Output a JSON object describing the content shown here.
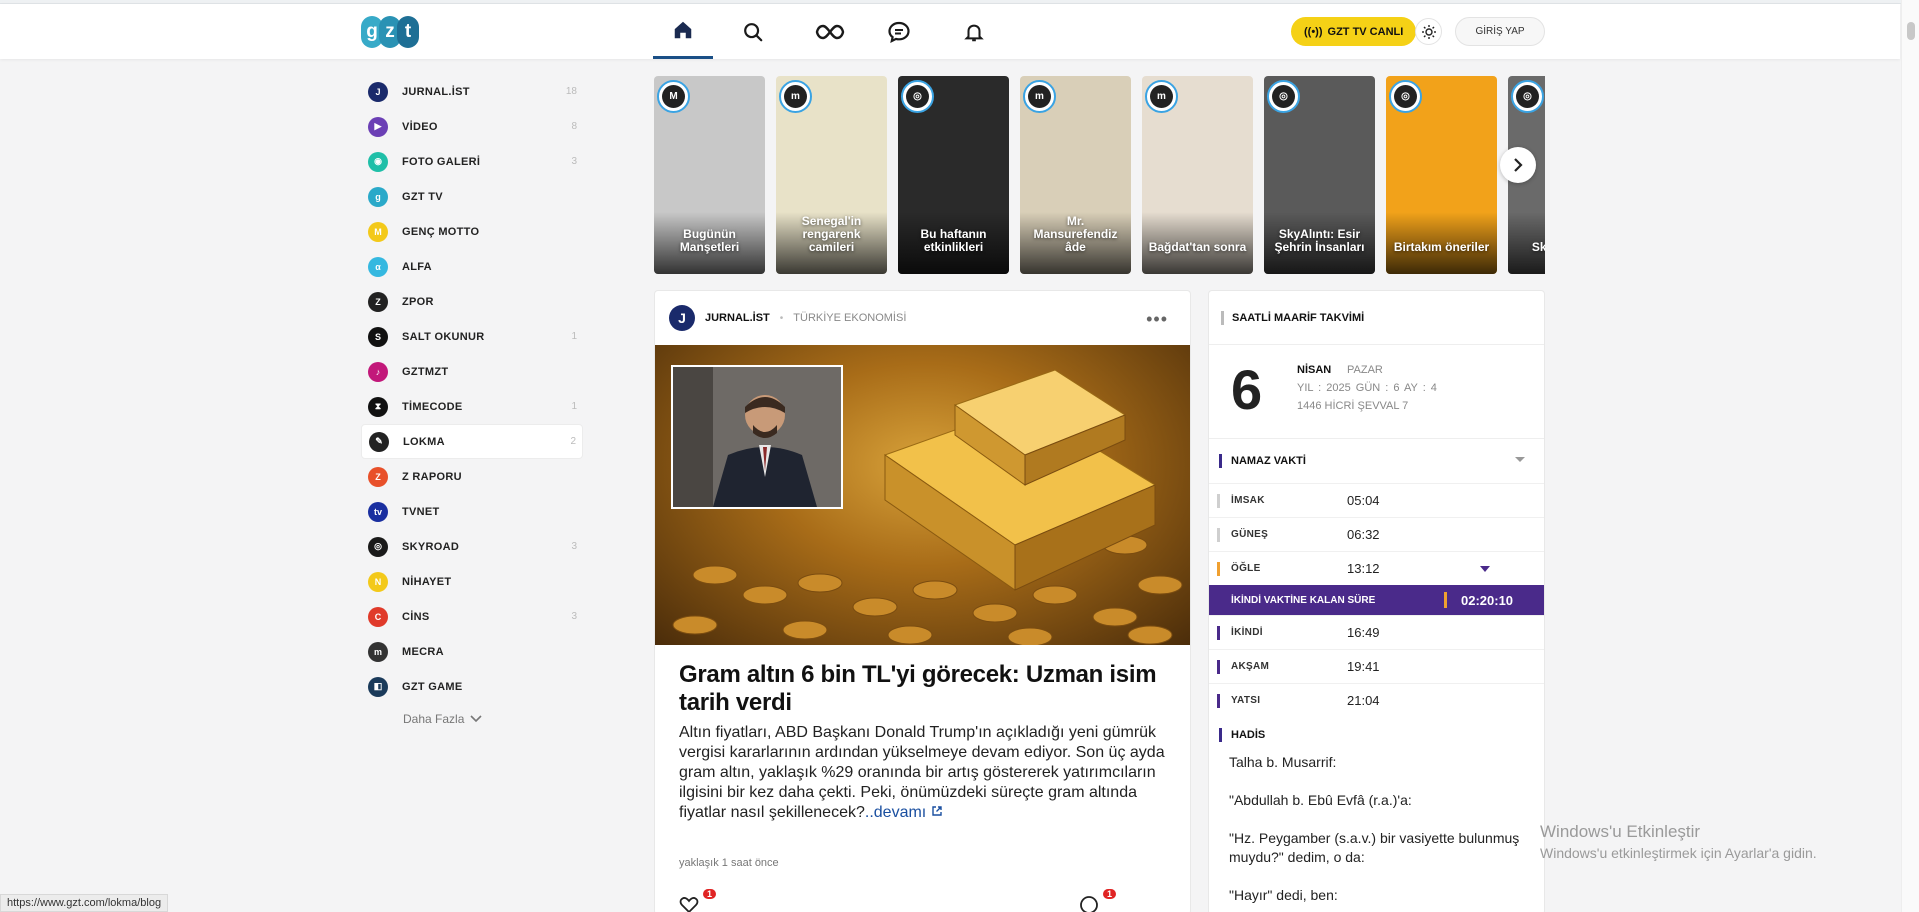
{
  "header": {
    "logo_letters": [
      "g",
      "z",
      "t"
    ],
    "tv_label": "GZT TV CANLI",
    "login_label": "GİRİŞ YAP"
  },
  "sidebar": {
    "items": [
      {
        "label": "JURNAL.İST",
        "count": "18",
        "icon": "J",
        "color": "#1a2a6b"
      },
      {
        "label": "VİDEO",
        "count": "8",
        "icon": "▶",
        "color": "#6b3fb5"
      },
      {
        "label": "FOTO GALERİ",
        "count": "3",
        "icon": "◉",
        "color": "#1fbfa8"
      },
      {
        "label": "GZT TV",
        "count": "",
        "icon": "g",
        "color": "#2aa9c9"
      },
      {
        "label": "GENÇ MOTTO",
        "count": "",
        "icon": "M",
        "color": "#f3c91a"
      },
      {
        "label": "ALFA",
        "count": "",
        "icon": "α",
        "color": "#35b8e0"
      },
      {
        "label": "ZPOR",
        "count": "",
        "icon": "Z",
        "color": "#222222"
      },
      {
        "label": "SALT OKUNUR",
        "count": "1",
        "icon": "S",
        "color": "#111111"
      },
      {
        "label": "GZTMZT",
        "count": "",
        "icon": "♪",
        "color": "#c2187a"
      },
      {
        "label": "TİMECODE",
        "count": "1",
        "icon": "⧗",
        "color": "#111111"
      },
      {
        "label": "LOKMA",
        "count": "2",
        "icon": "✎",
        "color": "#222222"
      },
      {
        "label": "Z RAPORU",
        "count": "",
        "icon": "Z",
        "color": "#e8502a"
      },
      {
        "label": "TVNET",
        "count": "",
        "icon": "tv",
        "color": "#1a2fa0"
      },
      {
        "label": "SKYROAD",
        "count": "3",
        "icon": "◎",
        "color": "#1a1a1a"
      },
      {
        "label": "NİHAYET",
        "count": "",
        "icon": "N",
        "color": "#f3c91a"
      },
      {
        "label": "CİNS",
        "count": "3",
        "icon": "C",
        "color": "#e03a2a"
      },
      {
        "label": "MECRA",
        "count": "",
        "icon": "m",
        "color": "#333333"
      },
      {
        "label": "GZT GAME",
        "count": "",
        "icon": "◧",
        "color": "#1a3a5a"
      }
    ],
    "more_label": "Daha Fazla"
  },
  "stories": [
    {
      "caption": "Bugünün Manşetleri",
      "bg": "#c8c8c8",
      "badge": "M"
    },
    {
      "caption": "Senegal'in rengarenk camileri",
      "bg": "#e8e2c8",
      "badge": "m"
    },
    {
      "caption": "Bu haftanın etkinlikleri",
      "bg": "#2a2a2a",
      "badge": "◎"
    },
    {
      "caption": "Mr. Mansurefendiz âde",
      "bg": "#d9cfb8",
      "badge": "m"
    },
    {
      "caption": "Bağdat'tan sonra",
      "bg": "#e6ddd0",
      "badge": "m"
    },
    {
      "caption": "SkyAlıntı: Esir Şehrin İnsanları",
      "bg": "#5a5a5a",
      "badge": "◎"
    },
    {
      "caption": "Birtakım öneriler",
      "bg": "#f2a21a",
      "badge": "◎"
    },
    {
      "caption": "Sky E Kütü",
      "bg": "#6a6a6a",
      "badge": "◎"
    }
  ],
  "article": {
    "source": "JURNAL.İST",
    "category": "TÜRKİYE EKONOMİSİ",
    "headline": "Gram altın 6 bin TL'yi görecek: Uzman isim tarih verdi",
    "summary": "Altın fiyatları, ABD Başkanı Donald Trump'ın açıkladığı yeni gümrük vergisi kararlarının ardından yükselmeye devam ediyor. Son üç ayda gram altın, yaklaşık %29 oranında bir artış göstererek yatırımcıların ilgisini bir kez daha çekti. Peki, önümüzdeki süreçte gram altında fiyatlar nasıl şekillenecek?",
    "more": "..devamı",
    "time": "yaklaşık 1 saat önce",
    "like_count": "1",
    "comment_count": "1"
  },
  "calendar": {
    "title": "SAATLİ MAARİF TAKVİMİ",
    "day": "6",
    "month": "NİSAN",
    "weekday": "PAZAR",
    "ymd": "YIL : 2025   GÜN : 6   AY : 4",
    "hijri": "1446 HİCRİ ŞEVVAL 7"
  },
  "prayer": {
    "title": "NAMAZ VAKTİ",
    "rows": [
      {
        "name": "İMSAK",
        "time": "05:04",
        "color": "#cfcfcf"
      },
      {
        "name": "GÜNEŞ",
        "time": "06:32",
        "color": "#cfcfcf"
      },
      {
        "name": "ÖĞLE",
        "time": "13:12",
        "color": "#f0a030"
      }
    ],
    "remaining_label": "İKİNDİ VAKTİNE KALAN SÜRE",
    "remaining_value": "02:20:10",
    "rows_after": [
      {
        "name": "İKİNDİ",
        "time": "16:49",
        "color": "#4a2a8a"
      },
      {
        "name": "AKŞAM",
        "time": "19:41",
        "color": "#4a2a8a"
      },
      {
        "name": "YATSI",
        "time": "21:04",
        "color": "#4a2a8a"
      }
    ]
  },
  "hadis": {
    "title": "HADİS",
    "paragraphs": [
      "Talha b. Musarrif:",
      "\"Abdullah b. Ebû Evfâ (r.a.)'a:",
      "\"Hz. Peygamber (s.a.v.) bir vasiyette bulunmuş muydu?\" dedim, o da:",
      "\"Hayır\" dedi, ben:"
    ]
  },
  "watermark": {
    "line1": "Windows'u Etkinleştir",
    "line2": "Windows'u etkinleştirmek için Ayarlar'a gidin."
  },
  "status_url": "https://www.gzt.com/lokma/blog"
}
